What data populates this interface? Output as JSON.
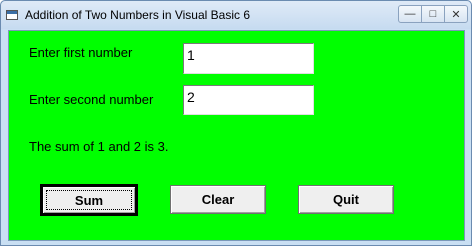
{
  "window": {
    "title": "Addition of Two Numbers in  Visual Basic 6",
    "controls": {
      "minimize": "—",
      "maximize": "□",
      "close": "✕"
    }
  },
  "form": {
    "first_label": "Enter first number",
    "first_value": "1",
    "second_label": "Enter second number",
    "second_value": "2",
    "result_text": "The sum of 1 and 2 is 3."
  },
  "buttons": {
    "sum": "Sum",
    "clear": "Clear",
    "quit": "Quit"
  },
  "colors": {
    "form_background": "#00ff00",
    "title_bar": "#c9dff3"
  }
}
